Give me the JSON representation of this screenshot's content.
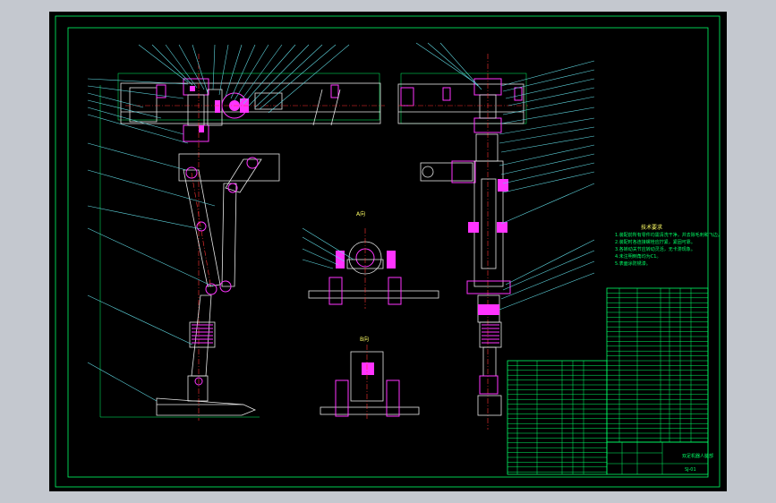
{
  "drawing": {
    "view_label_a": "A向",
    "view_label_b": "B向",
    "notes_title": "技术要求",
    "notes": [
      "1.装配前所有零件均需清洗干净，并去除毛刺和飞边。",
      "2.装配时各连接螺栓应拧紧，紧固可靠。",
      "3.各转动关节应转动灵活，无卡滞现象。",
      "4.未注明倒角均为C1。",
      "5.表面涂防锈漆。"
    ],
    "title_block_name": "双足机器人腿部",
    "drawing_number": "SJ-01",
    "accent_colors": {
      "outline": "#00ff66",
      "part": "#e6e6e6",
      "fastener": "#ff33ff",
      "centerline": "#ff3333",
      "leader": "#5fd7e0"
    }
  }
}
